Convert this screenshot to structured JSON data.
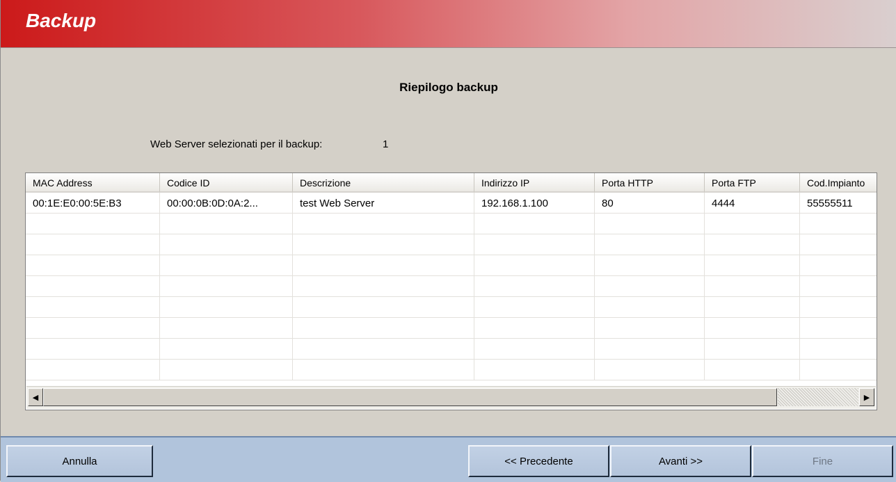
{
  "window": {
    "title": "Backup"
  },
  "page": {
    "heading": "Riepilogo backup",
    "summary_label": "Web Server selezionati per il backup:",
    "summary_count": "1"
  },
  "grid": {
    "columns": [
      "MAC Address",
      "Codice ID",
      "Descrizione",
      "Indirizzo IP",
      "Porta HTTP",
      "Porta FTP",
      "Cod.Impianto"
    ],
    "rows": [
      [
        "00:1E:E0:00:5E:B3",
        "00:00:0B:0D:0A:2...",
        "test Web Server",
        "192.168.1.100",
        "80",
        "4444",
        "55555511"
      ],
      [
        "",
        "",
        "",
        "",
        "",
        "",
        ""
      ],
      [
        "",
        "",
        "",
        "",
        "",
        "",
        ""
      ],
      [
        "",
        "",
        "",
        "",
        "",
        "",
        ""
      ],
      [
        "",
        "",
        "",
        "",
        "",
        "",
        ""
      ],
      [
        "",
        "",
        "",
        "",
        "",
        "",
        ""
      ],
      [
        "",
        "",
        "",
        "",
        "",
        "",
        ""
      ],
      [
        "",
        "",
        "",
        "",
        "",
        "",
        ""
      ],
      [
        "",
        "",
        "",
        "",
        "",
        "",
        ""
      ]
    ]
  },
  "footer": {
    "cancel_label": "Annulla",
    "prev_label": "<< Precedente",
    "next_label": "Avanti >>",
    "finish_label": "Fine"
  },
  "colors": {
    "title_gradient_start": "#cc1a1a",
    "footer_bg": "#b1c4dc",
    "window_bg": "#d4d0c8"
  }
}
